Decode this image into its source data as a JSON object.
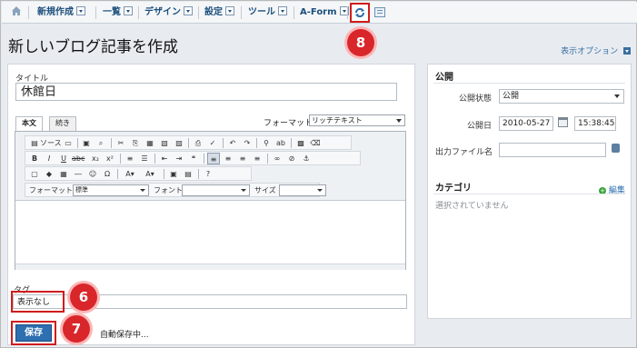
{
  "menu": {
    "items": [
      {
        "label": "新規作成"
      },
      {
        "label": "一覧"
      },
      {
        "label": "デザイン"
      },
      {
        "label": "設定"
      },
      {
        "label": "ツール"
      },
      {
        "label": "A-Form"
      }
    ],
    "home_icon": "home-icon",
    "refresh_icon": "refresh-icon",
    "list_icon": "list-view-icon"
  },
  "page": {
    "title": "新しいブログ記事を作成",
    "view_options": "表示オプション"
  },
  "form": {
    "title_label": "タイトル",
    "title_value": "休館日",
    "tabs": [
      "本文",
      "続き"
    ],
    "format_label": "フォーマット:",
    "format_value": "リッチテキスト",
    "toolbar": {
      "source_label": "ソース",
      "format_label": "フォーマット",
      "format_value": "標準",
      "font_label": "フォント",
      "size_label": "サイズ"
    },
    "tags_label": "タグ",
    "tags_value": "表示なし",
    "save_label": "保存",
    "autosave_text": "自動保存中..."
  },
  "publish": {
    "heading": "公開",
    "status_label": "公開状態",
    "status_value": "公開",
    "date_label": "公開日",
    "date_value": "2010-05-27",
    "time_value": "15:38:45",
    "filename_label": "出力ファイル名",
    "filename_value": "",
    "category_heading": "カテゴリ",
    "category_edit": "編集",
    "category_empty": "選択されていません"
  },
  "callouts": {
    "refresh": "8",
    "tags": "6",
    "save": "7"
  },
  "colors": {
    "accent": "#1c4f7c",
    "save_button": "#2d6fb0",
    "callout": "#d9262a"
  }
}
